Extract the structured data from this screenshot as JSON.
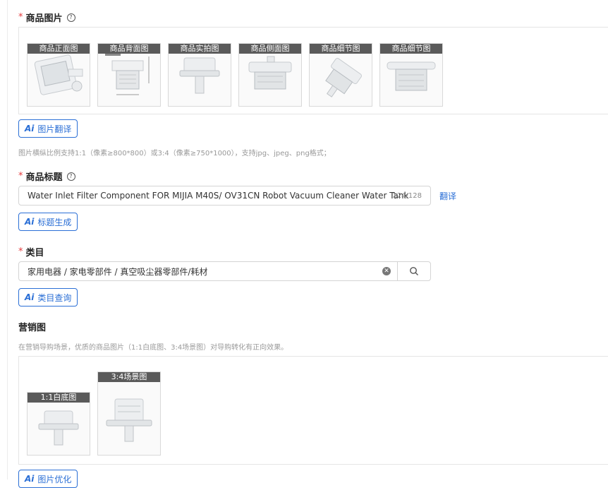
{
  "images_section": {
    "label": "商品图片",
    "thumbs": [
      "商品正面图",
      "商品背面图",
      "商品实拍图",
      "商品侧面图",
      "商品细节图",
      "商品细节图"
    ],
    "ai_button": "图片翻译",
    "hint": "图片横纵比例支持1:1（像素≥800*800）或3:4（像素≥750*1000），支持jpg、jpeg、png格式；"
  },
  "title_section": {
    "label": "商品标题",
    "value": "Water Inlet Filter Component FOR MIJIA M40S/ OV31CN Robot Vacuum Cleaner Water Tank",
    "counter": "124/128",
    "translate_link": "翻译",
    "ai_button": "标题生成"
  },
  "category_section": {
    "label": "类目",
    "value": "家用电器 / 家电零部件 / 真空吸尘器零部件/耗材",
    "ai_button": "类目查询"
  },
  "marketing_section": {
    "label": "营销图",
    "hint": "在营销导购场景，优质的商品图片（1:1白底图、3:4场景图）对导购转化有正向效果。",
    "thumbs": [
      "1:1白底图",
      "3:4场景图"
    ],
    "ai_button": "图片优化"
  },
  "ai_badge": "Ai",
  "required_mark": "*",
  "help_mark": "?",
  "icons": {
    "search": "search-icon",
    "clear": "clear-icon",
    "help": "question-circle-icon"
  }
}
